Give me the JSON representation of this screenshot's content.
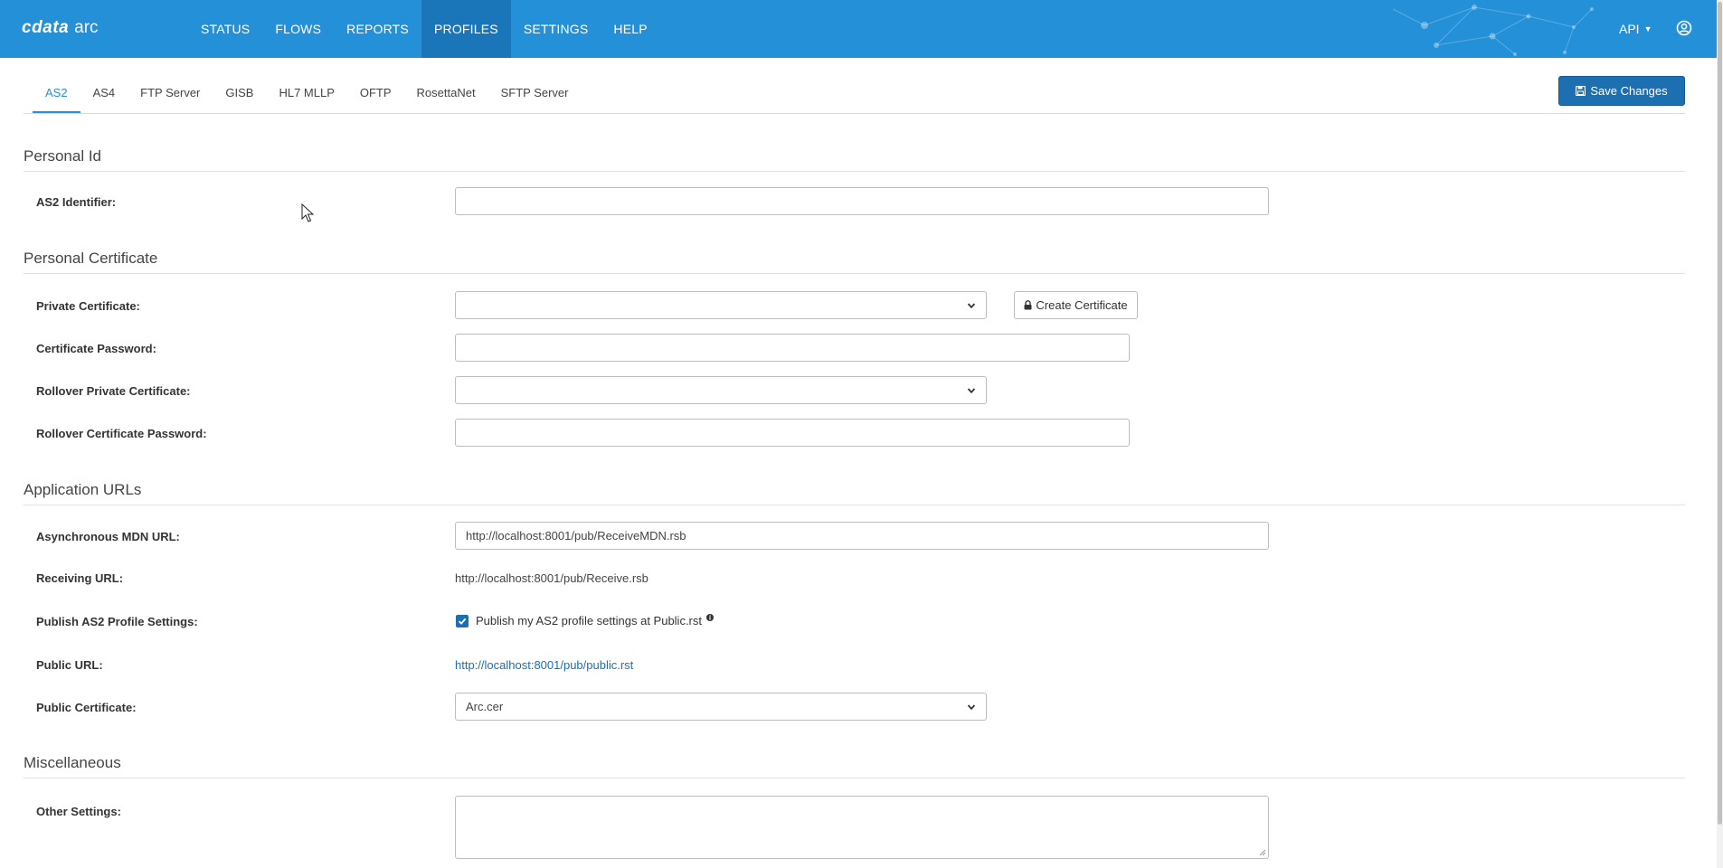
{
  "app": {
    "logo_brand": "cdata",
    "logo_product": "arc"
  },
  "nav": {
    "items": [
      "STATUS",
      "FLOWS",
      "REPORTS",
      "PROFILES",
      "SETTINGS",
      "HELP"
    ],
    "active": "PROFILES",
    "api_label": "API"
  },
  "tabs": {
    "items": [
      "AS2",
      "AS4",
      "FTP Server",
      "GISB",
      "HL7 MLLP",
      "OFTP",
      "RosettaNet",
      "SFTP Server"
    ],
    "active": "AS2"
  },
  "toolbar": {
    "save_label": "Save Changes"
  },
  "personal_id": {
    "title": "Personal Id",
    "as2_identifier_label": "AS2 Identifier:",
    "as2_identifier_value": ""
  },
  "personal_certificate": {
    "title": "Personal Certificate",
    "private_certificate_label": "Private Certificate:",
    "private_certificate_value": "",
    "create_certificate_label": "Create Certificate",
    "certificate_password_label": "Certificate Password:",
    "certificate_password_value": "",
    "rollover_private_certificate_label": "Rollover Private Certificate:",
    "rollover_private_certificate_value": "",
    "rollover_certificate_password_label": "Rollover Certificate Password:",
    "rollover_certificate_password_value": ""
  },
  "application_urls": {
    "title": "Application URLs",
    "async_mdn_url_label": "Asynchronous MDN URL:",
    "async_mdn_url_value": "http://localhost:8001/pub/ReceiveMDN.rsb",
    "receiving_url_label": "Receiving URL:",
    "receiving_url_value": "http://localhost:8001/pub/Receive.rsb",
    "publish_settings_label": "Publish AS2 Profile Settings:",
    "publish_checkbox_label": "Publish my AS2 profile settings at Public.rst",
    "publish_checked": true,
    "public_url_label": "Public URL:",
    "public_url_value": "http://localhost:8001/pub/public.rst",
    "public_certificate_label": "Public Certificate:",
    "public_certificate_value": "Arc.cer"
  },
  "miscellaneous": {
    "title": "Miscellaneous",
    "other_settings_label": "Other Settings:",
    "other_settings_value": ""
  },
  "colors": {
    "header": "#2390d7",
    "active_nav": "#1a76b8",
    "primary_button": "#1c6fb0",
    "link": "#1c6fb0"
  }
}
